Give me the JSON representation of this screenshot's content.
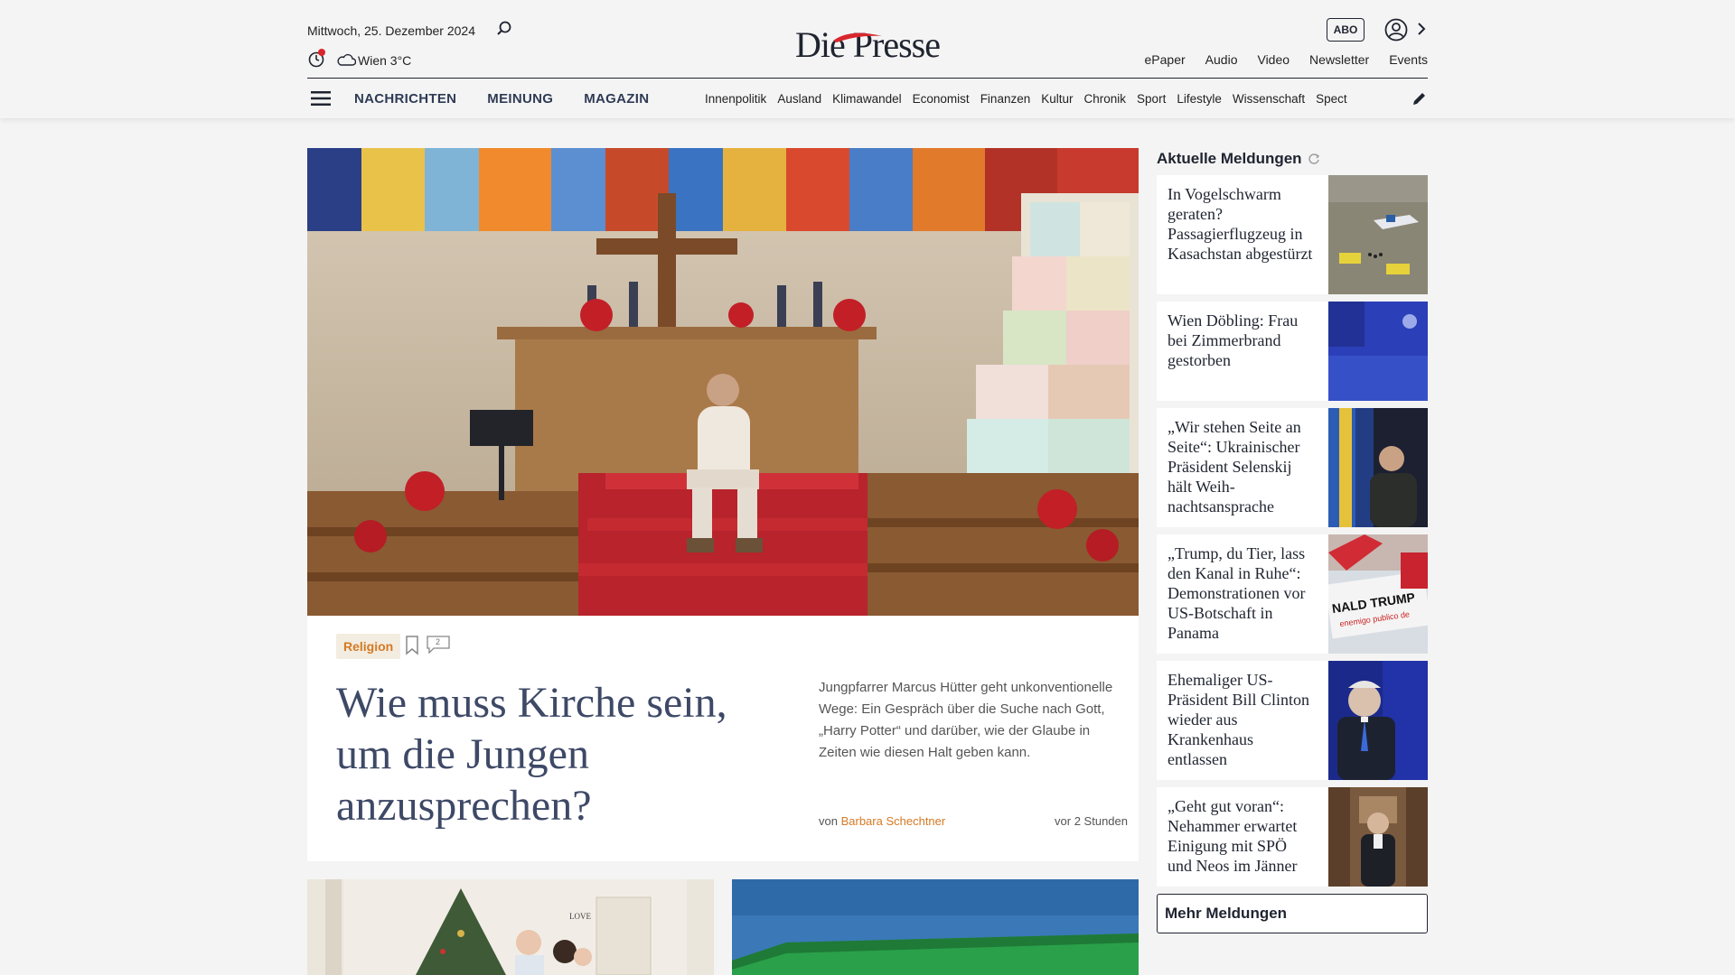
{
  "header": {
    "date": "Mittwoch, 25. Dezember 2024",
    "weather": "Wien 3°C",
    "logo": "Die Presse",
    "abo_label": "ABO",
    "quick_links": [
      "ePaper",
      "Audio",
      "Video",
      "Newsletter",
      "Events"
    ],
    "main_nav": [
      "NACHRICHTEN",
      "MEINUNG",
      "MAGAZIN"
    ],
    "sub_nav": [
      "Innenpolitik",
      "Ausland",
      "Klimawandel",
      "Economist",
      "Finanzen",
      "Kultur",
      "Chronik",
      "Sport",
      "Lifestyle",
      "Wissenschaft",
      "Spect"
    ]
  },
  "hero": {
    "tag": "Religion",
    "comment_count": "2",
    "headline": "Wie muss Kirche sein, um die Jungen anzusprechen?",
    "teaser": "Jungpfarrer Marcus Hütter geht unkonventionelle Wege: Ein Gespräch über die Suche nach Gott, „Harry Potter“ und darüber, wie der Glaube in Zeiten wie diesen Halt geben kann.",
    "byline_prefix": "von",
    "author": "Barbara Schechtner",
    "time": "vor 2 Stunden"
  },
  "rail": {
    "title": "Aktuelle Meldungen",
    "items": [
      {
        "text": "In Vogelschwarm geraten? Passagierflugzeug in Kasachstan abgestürzt"
      },
      {
        "text": "Wien Döbling: Frau bei Zimmerbrand gestorben"
      },
      {
        "text": "„Wir stehen Seite an Seite“: Ukrainischer Präsident Selenskij hält Weih-nachtsansprache"
      },
      {
        "text": "„Trump, du Tier, lass den Kanal in Ruhe“: Demonstrationen vor US-Botschaft in Panama"
      },
      {
        "text": "Ehemaliger US-Präsident Bill Clinton wieder aus Krankenhaus entlassen"
      },
      {
        "text": "„Geht gut voran“: Nehammer erwartet Einigung mit SPÖ und Neos im Jänner"
      }
    ],
    "more_label": "Mehr Meldungen"
  },
  "colors": {
    "accent": "#d47a24",
    "logo_red": "#d8262d",
    "headline": "#3d4966"
  }
}
